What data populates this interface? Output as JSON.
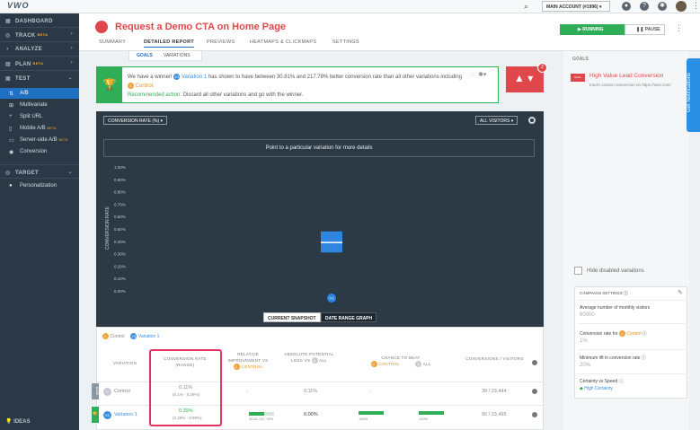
{
  "app": {
    "logo": "VWO",
    "account": "MAIN ACCOUNT (#1996)"
  },
  "sidebar": {
    "sections": [
      {
        "label": "DASHBOARD",
        "beta": "",
        "chev": ""
      },
      {
        "label": "TRACK",
        "beta": "BETA",
        "chev": "›"
      },
      {
        "label": "ANALYZE",
        "beta": "",
        "chev": "›"
      },
      {
        "label": "PLAN",
        "beta": "BETA",
        "chev": "›"
      },
      {
        "label": "TEST",
        "beta": "",
        "chev": "⌄"
      }
    ],
    "test_items": [
      {
        "label": "A/B",
        "beta": ""
      },
      {
        "label": "Multivariate",
        "beta": ""
      },
      {
        "label": "Split URL",
        "beta": ""
      },
      {
        "label": "Mobile A/B",
        "beta": "BETA"
      },
      {
        "label": "Server-side A/B",
        "beta": "BETA"
      },
      {
        "label": "Conversion",
        "beta": ""
      }
    ],
    "target": {
      "label": "TARGET",
      "chev": "⌄"
    },
    "target_items": [
      {
        "label": "Personalization"
      }
    ],
    "ideas": "IDEAS"
  },
  "header": {
    "title": "Request a Demo CTA on Home Page",
    "tabs": [
      "SUMMARY",
      "DETAILED REPORT",
      "PREVIEWS",
      "HEATMAPS & CLICKMAPS",
      "SETTINGS"
    ],
    "running": "RUNNING",
    "pause": "PAUSE",
    "subtabs": [
      "GOALS",
      "VARIATIONS"
    ]
  },
  "winner": {
    "pre": "We have a winner!",
    "variation": "Variation 1",
    "mid": "has shown to have between 30.81% and 217.78% better conversion rate than all other variations including",
    "control": "Control.",
    "rec_label": "Recommended action:",
    "rec_text": "Discard all other variations and go with the winner.",
    "alert_count": "2"
  },
  "chart": {
    "metric_dropdown": "CONVERSION RATE (%)",
    "visitors_dropdown": "ALL VISITORS",
    "info": "Point to a particular variation for more details",
    "ylabel": "CONVERSION RATE",
    "snapshot": "CURRENT SNAPSHOT",
    "range": "DATE RANGE GRAPH",
    "x_marker": "V1"
  },
  "chart_data": {
    "type": "bar",
    "categories": [
      "Variation 1"
    ],
    "ylabel": "CONVERSION RATE",
    "ticks": [
      "1.00%",
      "0.90%",
      "0.80%",
      "0.70%",
      "0.60%",
      "0.50%",
      "0.40%",
      "0.30%",
      "0.20%",
      "0.10%",
      "0.00%"
    ],
    "ylim": [
      0,
      1.0
    ],
    "series": [
      {
        "range_low": 0.31,
        "range_high": 0.48,
        "value": 0.39
      }
    ],
    "grid": false
  },
  "table": {
    "legend": [
      {
        "badge": "C",
        "label": "Control"
      },
      {
        "badge": "V1",
        "label": "Variation 1"
      }
    ],
    "headers": {
      "variation": "VARIATION",
      "conv_rate": "CONVERSION RATE",
      "conv_rate_sub": "(RANGE)",
      "rel_imp": "RELATIVE IMPROVEMENT VS",
      "rel_imp_ref": "CONTROL",
      "abs_loss": "ABSOLUTE POTENTIAL LOSS VS",
      "abs_loss_ref": "ALL",
      "chance": "CHANCE TO BEAT",
      "chance_a": "CONTROL",
      "chance_b": "ALL",
      "conversions": "CONVERSIONS / VISITORS"
    },
    "rows": [
      {
        "badge": "BASE",
        "dot": "C",
        "name": "Control",
        "rate": "0.11%",
        "range": "(0.1% - 0.26%)",
        "rel": "-",
        "loss": "0.11%",
        "chance_a": "-",
        "chance_b": "",
        "conv": "39 / 23,444"
      },
      {
        "badge": "🏆",
        "dot": "V1",
        "name": "Variation 1",
        "rate": "0.39%",
        "range": "(0.29% - 0.59%)",
        "rel": "30.81-217.78%",
        "loss": "0.00%",
        "chance_a": "100%",
        "chance_b": "100%",
        "conv": "90 / 23,495",
        "bar_rel": 0.6,
        "bar_a": 1.0,
        "bar_b": 1.0
      }
    ]
  },
  "right": {
    "goals_title": "GOALS",
    "goal_icon": "GOAL",
    "goal_name": "High Value Lead Conversion",
    "goal_sub": "tracks custom conversion on https://vwo.com/",
    "hide_disabled": "Hide disabled variations",
    "settings_title": "CAMPAIGN SETTINGS",
    "avg_label": "Average number of monthly visitors",
    "avg_val": "60000",
    "conv_label": "Conversion rate for",
    "conv_ref": "Control",
    "conv_val": "1%",
    "lift_label": "Minimum lift in conversion rate",
    "lift_val": "20%",
    "cert_label": "Certainty vs Speed",
    "cert_val": "High Certainty"
  },
  "notifications": "Get Notifications",
  "colors": {
    "accent": "#1f70c1",
    "success": "#2fae57",
    "danger": "#e0474c",
    "highlight": "#e3335f"
  }
}
